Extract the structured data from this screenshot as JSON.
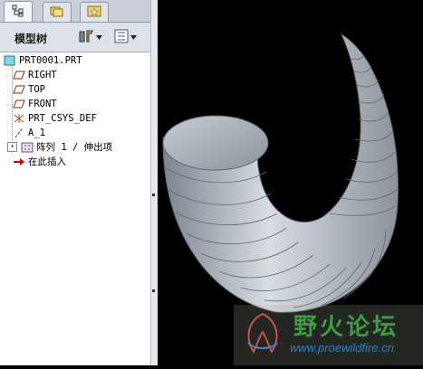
{
  "panel": {
    "tabs": [
      {
        "icon": "model-tree-icon"
      },
      {
        "icon": "folder-browser-icon"
      },
      {
        "icon": "favorites-icon"
      }
    ],
    "title": "模型树",
    "settings_icon": "tree-settings-icon",
    "show_icon": "tree-show-icon"
  },
  "tree": {
    "root": "PRT0001.PRT",
    "items": [
      {
        "label": "RIGHT",
        "icon": "datum-plane-icon"
      },
      {
        "label": "TOP",
        "icon": "datum-plane-icon"
      },
      {
        "label": "FRONT",
        "icon": "datum-plane-icon"
      },
      {
        "label": "PRT_CSYS_DEF",
        "icon": "coordinate-system-icon"
      },
      {
        "label": "A_1",
        "icon": "datum-axis-icon"
      },
      {
        "label": "阵列 1 / 伸出项",
        "icon": "pattern-icon"
      },
      {
        "label": "在此插入",
        "icon": "insert-here-arrow-icon"
      }
    ]
  },
  "watermark": {
    "text": "野火论坛",
    "url": "www.proewildfire.cn"
  },
  "colors": {
    "panel_bg": "#d6dbe3",
    "tree_bg": "#ffffff",
    "viewport_bg": "#000000",
    "model": "#b9c1c8",
    "datum_plane": "#a0522d",
    "insert_arrow": "#cc0000"
  }
}
